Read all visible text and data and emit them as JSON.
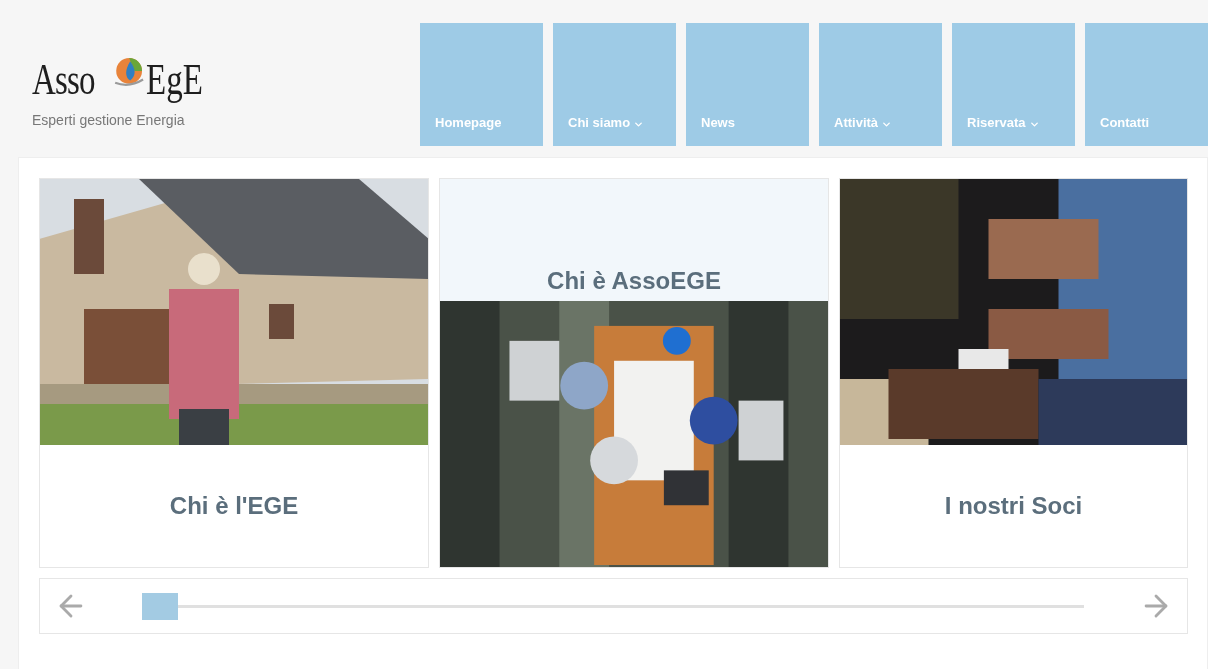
{
  "logo": {
    "word_left": "Asso",
    "word_right": "EgE",
    "tagline": "Esperti gestione Energia"
  },
  "nav": [
    {
      "label": "Homepage",
      "dropdown": false
    },
    {
      "label": "Chi siamo",
      "dropdown": true
    },
    {
      "label": "News",
      "dropdown": false
    },
    {
      "label": "Attività",
      "dropdown": true
    },
    {
      "label": "Riservata",
      "dropdown": true
    },
    {
      "label": "Contatti",
      "dropdown": false
    }
  ],
  "cards": [
    {
      "title": "Chi è l'EGE",
      "kind": "photo_top"
    },
    {
      "title": "Chi è AssoEGE",
      "kind": "photo_bottom"
    },
    {
      "title": "I nostri Soci",
      "kind": "photo_top"
    }
  ]
}
